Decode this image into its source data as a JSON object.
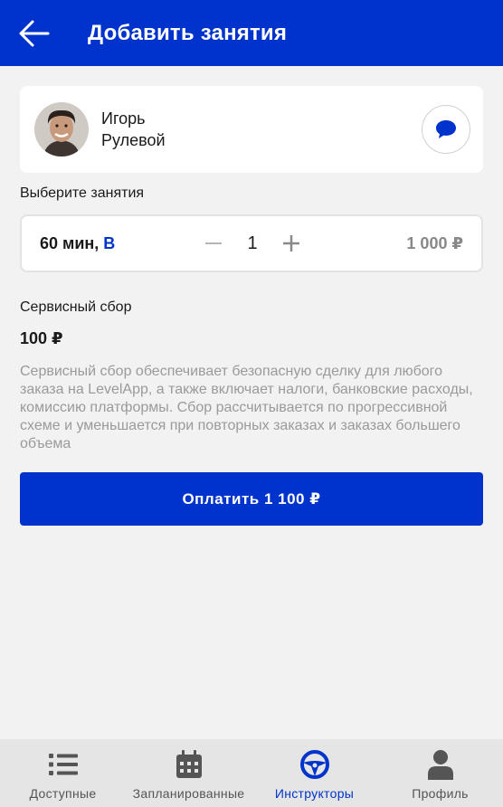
{
  "header": {
    "title": "Добавить занятия",
    "back_icon": "arrow-left-icon"
  },
  "instructor": {
    "first_name": "Игорь",
    "last_name": "Рулевой",
    "chat_icon": "chat-bubble-icon"
  },
  "selection": {
    "label": "Выберите занятия",
    "duration": "60 мин, ",
    "transmission": "В",
    "quantity": "1",
    "price": "1 000 ₽",
    "decrement_icon": "minus-icon",
    "increment_icon": "plus-icon"
  },
  "service_fee": {
    "title": "Сервисный сбор",
    "amount": "100 ₽",
    "description": "Сервисный сбор обеспечивает безопасную сделку для любого заказа на LevelApp, а также включает налоги, банковские расходы, комиссию платформы. Сбор рассчитывается по прогрессивной схеме и уменьшается при повторных заказах и заказах большего объема"
  },
  "pay_button": {
    "label": "Оплатить 1 100 ₽"
  },
  "bottom_nav": {
    "items": [
      {
        "label": "Доступные",
        "icon": "list-icon",
        "active": false
      },
      {
        "label": "Запланированные",
        "icon": "calendar-icon",
        "active": false
      },
      {
        "label": "Инструкторы",
        "icon": "steering-wheel-icon",
        "active": true
      },
      {
        "label": "Профиль",
        "icon": "user-icon",
        "active": false
      }
    ]
  },
  "colors": {
    "primary": "#0033cc",
    "background": "#f2f2f2",
    "muted_text": "#9a9a9a"
  }
}
